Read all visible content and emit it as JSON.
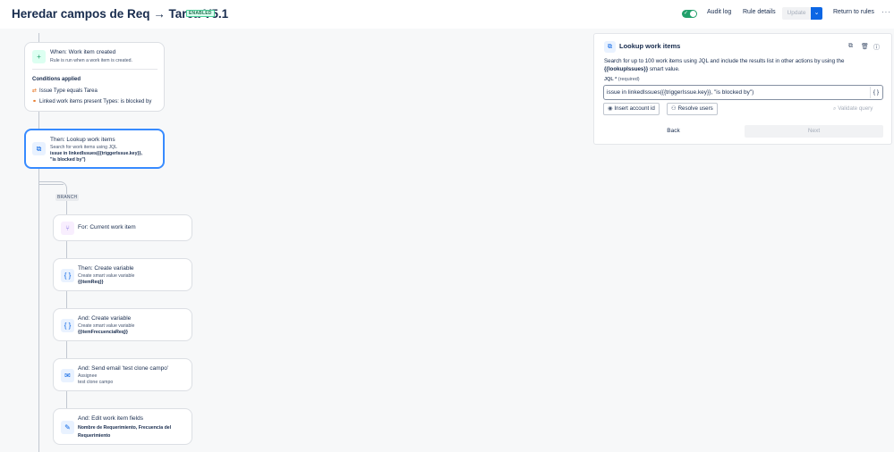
{
  "header": {
    "title": "Heredar campos de Req → Tarea V5.1",
    "status_lozenge": "ENABLED",
    "audit_log": "Audit log",
    "rule_details": "Rule details",
    "update": "Update",
    "return_to_rules": "Return to rules",
    "more": "···"
  },
  "trigger": {
    "title": "When: Work item created",
    "subtitle": "Rule is run when a work item is created.",
    "conditions_heading": "Conditions applied",
    "conditions": [
      "Issue Type equals Tarea",
      "Linked work items present Types: is blocked by"
    ]
  },
  "lookup_card": {
    "title": "Then: Lookup work items",
    "subtitle": "Search for work items using JQL",
    "query_line1": "issue in linkedIssues({{triggerIssue.key}},",
    "query_line2": "\"is blocked by\")"
  },
  "branch": {
    "tag": "BRANCH",
    "items": [
      {
        "title": "For: Current work item",
        "lines": []
      },
      {
        "title": "Then: Create variable",
        "lines": [
          "Create smart value variable"
        ],
        "bold": [
          "{{itemReq}}"
        ]
      },
      {
        "title": "And: Create variable",
        "lines": [
          "Create smart value variable"
        ],
        "bold": [
          "{{itemFrecuenciaReq}}"
        ]
      },
      {
        "title": "And: Send email 'test clone campo'",
        "lines": [
          "Assignee",
          "test clone campo"
        ],
        "bold": []
      },
      {
        "title": "And: Edit work item fields",
        "lines": [],
        "bold": [
          "Nombre de Requerimiento, Frecuencia del",
          "Requerimiento"
        ]
      }
    ]
  },
  "panel": {
    "title": "Lookup work items",
    "desc_text": "Search for up to 100 work items using JQL and include the results list in other actions by using the",
    "desc_smart": "{{lookupIssues}}",
    "desc_suffix": " smart value.",
    "jql_label": "JQL *",
    "jql_required": "(required)",
    "jql_value": "issue in linkedIssues({{triggerIssue.key}}, \"is blocked by\")",
    "jql_brace": "{ }",
    "insert_account": "Insert account id",
    "resolve_users": "Resolve users",
    "validate_query": "Validate query",
    "back": "Back",
    "next": "Next"
  },
  "colors": {
    "accent": "#0c66e4",
    "selected_border": "#388bff",
    "enabled_green": "#22a06b"
  }
}
